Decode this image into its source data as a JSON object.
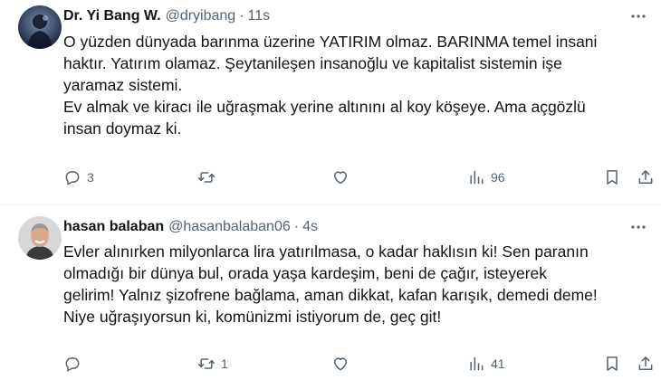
{
  "tweets": [
    {
      "author": {
        "display_name": "Dr. Yi Bang W.",
        "handle": "@dryibang",
        "time": "11s"
      },
      "lines": [
        "O yüzden dünyada barınma üzerine YATIRIM olmaz. BARINMA temel insani",
        "haktır. Yatırım olamaz. Şeytanileşen insanoğlu ve kapitalist sistemin işe",
        "yaramaz sistemi.",
        "Ev almak ve kiracı ile uğraşmak yerine altınını al koy köşeye. Ama açgözlü",
        "insan doymaz ki."
      ],
      "stats": {
        "replies": "3",
        "retweets": "",
        "likes": "",
        "views": "96"
      },
      "icons": {
        "more": "more-icon",
        "reply": "reply-icon",
        "retweet": "retweet-icon",
        "like": "heart-icon",
        "views": "views-icon",
        "bookmark": "bookmark-icon",
        "share": "share-icon"
      },
      "colors": {
        "avatar": "#2a3a55"
      }
    },
    {
      "author": {
        "display_name": "hasan balaban",
        "handle": "@hasanbalaban06",
        "time": "4s"
      },
      "lines": [
        "Evler alınırken milyonlarca lira yatırılmasa, o kadar haklısın ki! Sen paranın",
        "olmadığı bir dünya bul, orada yaşa kardeşim, beni de çağır, isteyerek",
        "gelirim! Yalnız şizofrene bağlama, aman dikkat, kafan karışık, demedi deme!",
        "Niye uğraşıyorsun ki, komünizmi istiyorum de, geç git!"
      ],
      "stats": {
        "replies": "",
        "retweets": "1",
        "likes": "",
        "views": "41"
      },
      "icons": {
        "more": "more-icon",
        "reply": "reply-icon",
        "retweet": "retweet-icon",
        "like": "heart-icon",
        "views": "views-icon",
        "bookmark": "bookmark-icon",
        "share": "share-icon"
      },
      "colors": {
        "avatar": "#c9c9c9"
      }
    }
  ],
  "colors": {
    "text": "#0f1419",
    "secondary": "#536471",
    "divider": "#eff3f4"
  }
}
